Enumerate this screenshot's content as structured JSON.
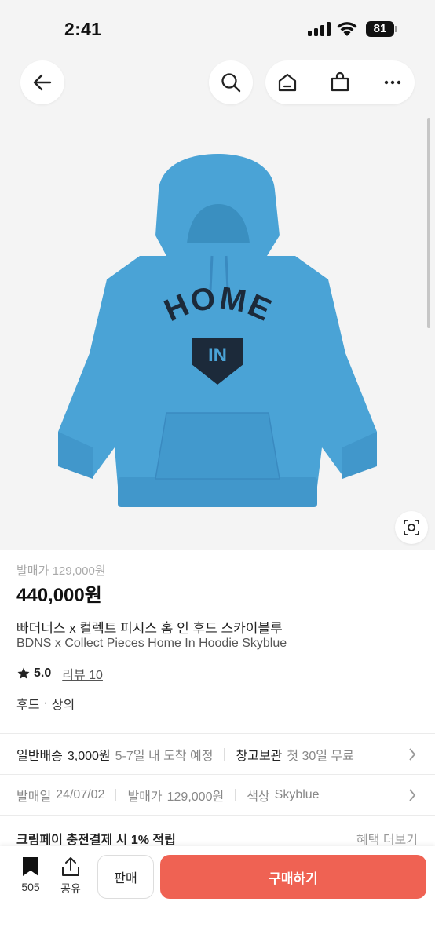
{
  "status_bar": {
    "time": "2:41",
    "battery": "81"
  },
  "nav": {
    "back_icon": "arrow-left-icon",
    "search_icon": "search-icon",
    "home_icon": "home-icon",
    "bag_icon": "shopping-bag-icon",
    "more_icon": "more-horizontal-icon"
  },
  "product": {
    "image_text_top": "HOME",
    "image_text_badge": "IN",
    "release_price_label": "발매가 129,000원",
    "price": "440,000원",
    "title_ko": "빠더너스 x 컬렉트 피시스 홈 인 후드 스카이블루",
    "title_en": "BDNS x Collect Pieces Home In Hoodie Skyblue",
    "rating": "5.0",
    "review": "리뷰 10",
    "categories": [
      "후드",
      "상의"
    ],
    "category_sep": "·"
  },
  "shipping": {
    "standard_label": "일반배송",
    "standard_value": "3,000원",
    "standard_eta": "5-7일 내 도착 예정",
    "storage_label": "창고보관",
    "storage_value": "첫 30일 무료"
  },
  "details": {
    "release_date_label": "발매일",
    "release_date": "24/07/02",
    "release_price_label": "발매가",
    "release_price": "129,000원",
    "color_label": "색상",
    "color": "Skyblue"
  },
  "benefit": {
    "text": "크림페이 충전결제 시 1% 적립",
    "more": "혜택 더보기"
  },
  "bottom_bar": {
    "bookmark_count": "505",
    "share_label": "공유",
    "sell_label": "판매",
    "buy_label": "구매하기"
  },
  "colors": {
    "buy_button": "#ef6253",
    "hoodie": "#4aa3d6",
    "background": "#f4f4f4"
  }
}
